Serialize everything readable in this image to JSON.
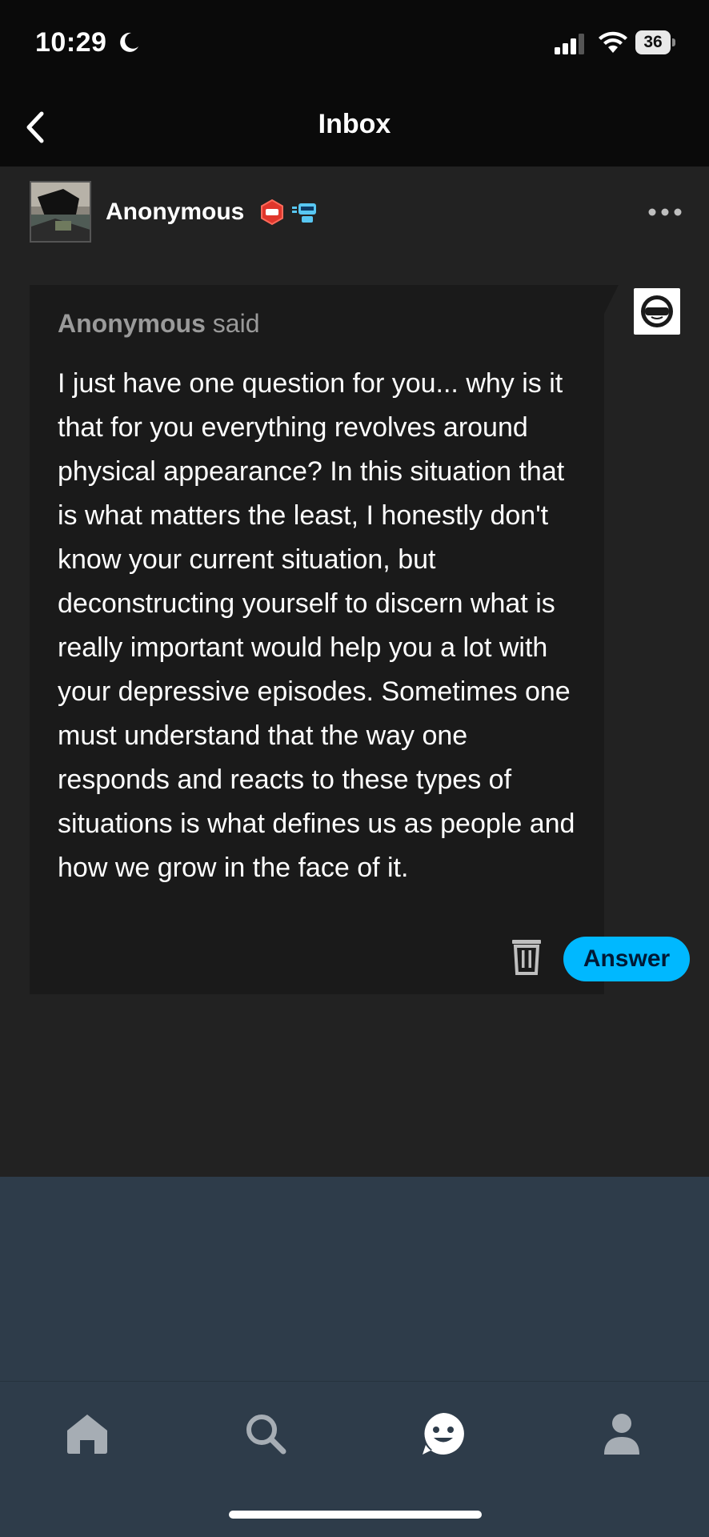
{
  "status_bar": {
    "time": "10:29",
    "battery_level": "36",
    "icons": [
      "moon-icon",
      "signal-icon",
      "wifi-icon",
      "battery-icon"
    ]
  },
  "nav": {
    "title": "Inbox",
    "back_icon": "chevron-left-icon"
  },
  "post": {
    "author": "Anonymous",
    "badges": [
      "hexagon-badge-icon",
      "robot-badge-icon"
    ],
    "more_icon": "more-dots-icon",
    "ask": {
      "asker": "Anonymous",
      "said_label": "said",
      "question": "I just have one question for you... why is it that for you everything revolves around physical appearance? In this situation that is what matters the least, I honestly don't know your current situation, but deconstructing yourself to discern what is really important would help you a lot with your depressive episodes. Sometimes one must understand that the way one responds and reacts to these types of situations is what defines us as people and how we grow in the face of it."
    },
    "actions": {
      "delete_icon": "trash-icon",
      "answer_label": "Answer"
    }
  },
  "tab_bar": {
    "tabs": [
      {
        "name": "home",
        "icon": "home-icon"
      },
      {
        "name": "search",
        "icon": "search-icon"
      },
      {
        "name": "activity",
        "icon": "smiley-icon",
        "active": true
      },
      {
        "name": "account",
        "icon": "person-icon"
      }
    ]
  },
  "colors": {
    "accent": "#00b8ff",
    "card_background": "#222222",
    "tab_bar_background": "#2e3c4a",
    "inactive_icon": "#a6adb4"
  }
}
